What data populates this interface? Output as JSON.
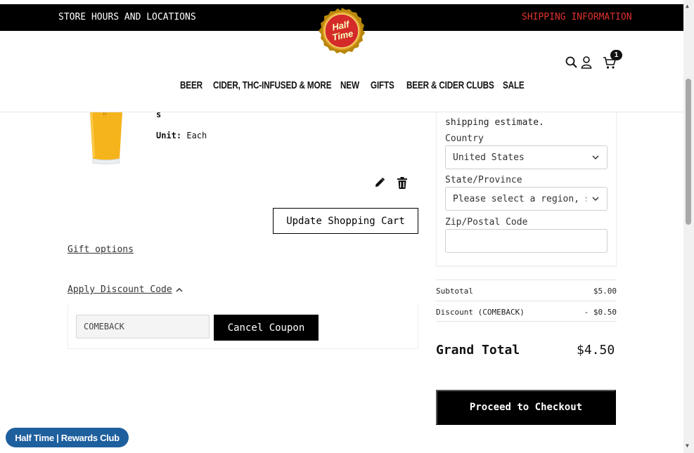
{
  "topbar": {
    "store_hours": "STORE HOURS AND LOCATIONS",
    "shipping_info": "SHIPPING INFORMATION"
  },
  "logo": {
    "line1": "Half",
    "line2": "Time"
  },
  "header": {
    "cart_count": "1",
    "nav": [
      "BEER",
      "CIDER, THC-INFUSED & MORE",
      "NEW",
      "GIFTS",
      "BEER & CIDER CLUBS",
      "SALE"
    ]
  },
  "product": {
    "name_fragment": "s",
    "unit_label": "Unit:",
    "unit_value": "Each"
  },
  "cart": {
    "update_label": "Update Shopping Cart",
    "gift_options": "Gift options",
    "apply_discount": "Apply Discount Code",
    "coupon_value": "COMEBACK",
    "cancel_coupon": "Cancel Coupon"
  },
  "shipping": {
    "intro_fragment": "shipping estimate.",
    "country_label": "Country",
    "country_value": "United States",
    "state_label": "State/Province",
    "state_value": "Please select a region, state or province.",
    "zip_label": "Zip/Postal Code",
    "zip_value": ""
  },
  "summary": {
    "subtotal_label": "Subtotal",
    "subtotal_value": "$5.00",
    "discount_label": "Discount (COMEBACK)",
    "discount_value": "- $0.50",
    "grand_total_label": "Grand Total",
    "grand_total_value": "$4.50",
    "checkout_label": "Proceed to Checkout"
  },
  "rewards": {
    "label": "Half Time | Rewards Club"
  },
  "colors": {
    "topbar_bg": "#000000",
    "shipping_link": "#e0322e",
    "logo_red": "#d42a2a",
    "logo_gold": "#e3a52a",
    "rewards_bg": "#1e5f9e",
    "button_bg": "#000000"
  },
  "icons": {
    "search": "search-icon",
    "account": "user-icon",
    "cart": "cart-icon",
    "edit": "pencil-icon",
    "delete": "trash-icon",
    "select": "chevron-down-icon",
    "discount_toggle": "chevron-up-icon"
  }
}
